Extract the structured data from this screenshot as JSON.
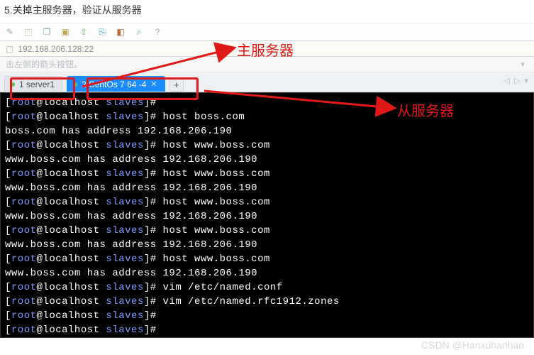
{
  "caption": "5.关掉主服务器，验证从服务器",
  "addressBar": {
    "host": "192.168.206.128:22"
  },
  "navstrip_hint": "击左侧的箭头按钮。",
  "toolbar": {
    "icons": [
      "pencil",
      "save",
      "overlap",
      "folder",
      "share",
      "clipboard",
      "square",
      "zoom",
      "help"
    ]
  },
  "tabs": [
    {
      "label": "1 server1",
      "active": false,
      "statusColor": "#5fbf5f"
    },
    {
      "label": "2 CentOs 7 64 -4",
      "active": true,
      "statusColor": "#5fbf5f"
    }
  ],
  "newTabGlyph": "+",
  "annotations": {
    "primaryLabel": "主服务器",
    "secondaryLabel": "从服务器"
  },
  "terminal": {
    "prompt_open": "[",
    "user": "root",
    "at": "@",
    "host": "localhost",
    "dir": " slaves",
    "prompt_close": "]#",
    "lines": [
      {
        "cmd": ""
      },
      {
        "cmd": " host boss.com"
      },
      {
        "out": "boss.com has address 192.168.206.190"
      },
      {
        "cmd": " host www.boss.com"
      },
      {
        "out": "www.boss.com has address 192.168.206.190"
      },
      {
        "cmd": " host www.boss.com"
      },
      {
        "out": "www.boss.com has address 192.168.206.190"
      },
      {
        "cmd": " host www.boss.com"
      },
      {
        "out": "www.boss.com has address 192.168.206.190"
      },
      {
        "cmd": " host www.boss.com"
      },
      {
        "out": "www.boss.com has address 192.168.206.190"
      },
      {
        "cmd": " host www.boss.com"
      },
      {
        "out": "www.boss.com has address 192.168.206.190"
      },
      {
        "cmd": " vim /etc/named.conf"
      },
      {
        "cmd": " vim /etc/named.rfc1912.zones"
      },
      {
        "cmd": ""
      },
      {
        "cmd": ""
      }
    ]
  },
  "watermark": "CSDN @Hanxuhanhan"
}
